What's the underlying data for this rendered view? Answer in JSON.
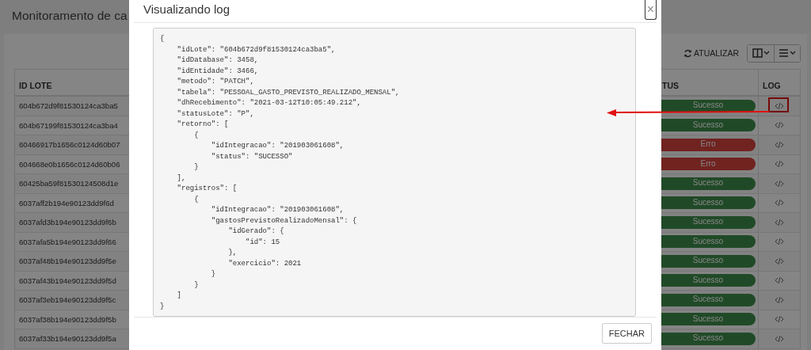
{
  "page": {
    "title": "Monitoramento de ca"
  },
  "toolbar": {
    "refresh_label": "ATUALIZAR"
  },
  "table": {
    "columns": [
      "ID LOTE",
      "TUS",
      "LOG"
    ],
    "rows": [
      {
        "id": "604b672d9f81530124ca3ba5",
        "status": "Sucesso",
        "kind": "success",
        "highlighted": true
      },
      {
        "id": "604b67199f81530124ca3ba4",
        "status": "Sucesso",
        "kind": "success",
        "highlighted": false
      },
      {
        "id": "60466917b1656c0124d60b07",
        "status": "Erro",
        "kind": "error",
        "highlighted": false
      },
      {
        "id": "604668e0b1656c0124d60b06",
        "status": "Erro",
        "kind": "error",
        "highlighted": false
      },
      {
        "id": "60425ba59f81530124508d1e",
        "status": "Sucesso",
        "kind": "success",
        "highlighted": false
      },
      {
        "id": "6037aff2b194e90123dd9f6d",
        "status": "Sucesso",
        "kind": "success",
        "highlighted": false
      },
      {
        "id": "6037afd3b194e90123dd9f6b",
        "status": "Sucesso",
        "kind": "success",
        "highlighted": false
      },
      {
        "id": "6037afa5b194e90123dd9f66",
        "status": "Sucesso",
        "kind": "success",
        "highlighted": false
      },
      {
        "id": "6037af48b194e90123dd9f5e",
        "status": "Sucesso",
        "kind": "success",
        "highlighted": false
      },
      {
        "id": "6037af43b194e90123dd9f5d",
        "status": "Sucesso",
        "kind": "success",
        "highlighted": false
      },
      {
        "id": "6037af3eb194e90123dd9f5c",
        "status": "Sucesso",
        "kind": "success",
        "highlighted": false
      },
      {
        "id": "6037af38b194e90123dd9f5b",
        "status": "Sucesso",
        "kind": "success",
        "highlighted": false
      },
      {
        "id": "6037af33b194e90123dd9f5a",
        "status": "Sucesso",
        "kind": "success",
        "highlighted": false
      }
    ]
  },
  "modal": {
    "title": "Visualizando log",
    "close": "×",
    "close_button": "FECHAR",
    "log_lines": [
      "{",
      "    \"idLote\": \"604b672d9f81530124ca3ba5\",",
      "    \"idDatabase\": 3458,",
      "    \"idEntidade\": 3466,",
      "    \"metodo\": \"PATCH\",",
      "    \"tabela\": \"PESSOAL_GASTO_PREVISTO_REALIZADO_MENSAL\",",
      "    \"dhRecebimento\": \"2021-03-12T10:05:49.212\",",
      "    \"statusLote\": \"P\",",
      "    \"retorno\": [",
      "        {",
      "            \"idIntegracao\": \"201903061608\",",
      "            \"status\": \"SUCESSO\"",
      "        }",
      "    ],",
      "    \"registros\": [",
      "        {",
      "            \"idIntegracao\": \"201903061608\",",
      "            \"gastosPrevistoRealizadoMensal\": {",
      "                \"idGerado\": {",
      "                    \"id\": 15",
      "                },",
      "                \"exercicio\": 2021",
      "            }",
      "        }",
      "    ]",
      "}"
    ]
  }
}
